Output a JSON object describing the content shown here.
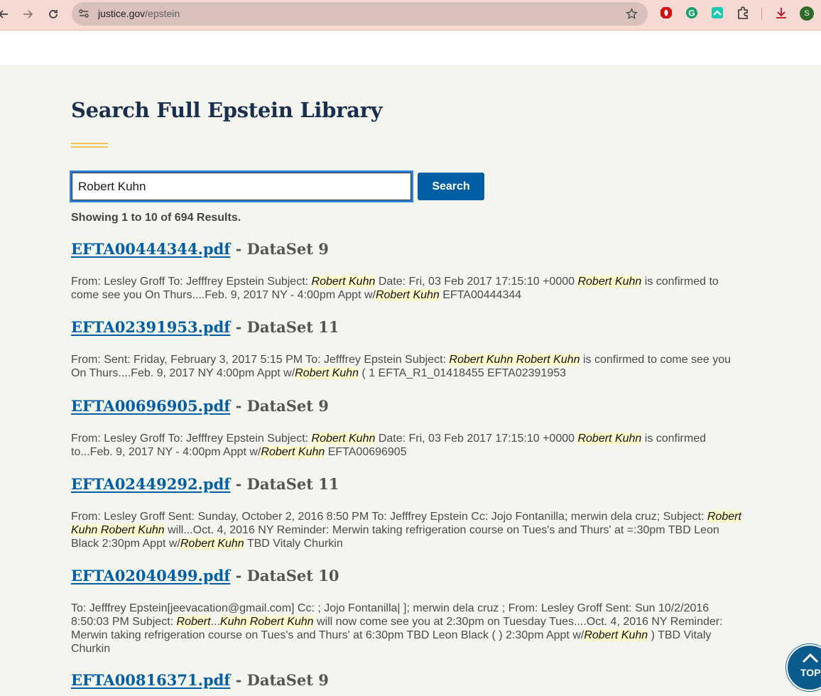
{
  "browser": {
    "url_host": "justice.gov",
    "url_path": "/epstein",
    "avatar_letter": "S"
  },
  "page": {
    "title": "Search Full Epstein Library",
    "search_value": "Robert Kuhn",
    "search_button": "Search",
    "results_count": "Showing 1 to 10 of 694 Results.",
    "top_label": "TOP"
  },
  "results": [
    {
      "file": "EFTA00444344.pdf",
      "dataset": " - DataSet 9",
      "snippet": [
        {
          "t": "From: Lesley Groff To: Jefffrey Epstein Subject: "
        },
        {
          "h": "Robert Kuhn"
        },
        {
          "t": " Date: Fri, 03 Feb 2017 17:15:10 +0000 "
        },
        {
          "h": "Robert Kuhn"
        },
        {
          "t": " is confirmed to come see you On Thurs....Feb. 9, 2017 NY - 4:00pm Appt w/"
        },
        {
          "h": "Robert Kuhn"
        },
        {
          "t": " EFTA00444344"
        }
      ]
    },
    {
      "file": "EFTA02391953.pdf",
      "dataset": " - DataSet 11",
      "snippet": [
        {
          "t": "From: Sent: Friday, February 3, 2017 5:15 PM To: Jefffrey Epstein Subject: "
        },
        {
          "h": "Robert Kuhn Robert Kuhn"
        },
        {
          "t": " is confirmed to come see you On Thurs....Feb. 9, 2017 NY 4:00pm Appt w/"
        },
        {
          "h": "Robert Kuhn"
        },
        {
          "t": " ( 1 EFTA_R1_01418455 EFTA02391953"
        }
      ]
    },
    {
      "file": "EFTA00696905.pdf",
      "dataset": " - DataSet 9",
      "snippet": [
        {
          "t": "From: Lesley Groff To: Jefffrey Epstein Subject: "
        },
        {
          "h": "Robert Kuhn"
        },
        {
          "t": " Date: Fri, 03 Feb 2017 17:15:10 +0000 "
        },
        {
          "h": "Robert Kuhn"
        },
        {
          "t": " is confirmed to...Feb. 9, 2017 NY - 4:00pm Appt w/"
        },
        {
          "h": "Robert Kuhn"
        },
        {
          "t": " EFTA00696905"
        }
      ]
    },
    {
      "file": "EFTA02449292.pdf",
      "dataset": " - DataSet 11",
      "snippet": [
        {
          "t": "From: Lesley Groff Sent: Sunday, October 2, 2016 8:50 PM To: Jefffrey Epstein Cc: Jojo Fontanilla; merwin dela cruz; Subject: "
        },
        {
          "h": "Robert Kuhn Robert Kuhn"
        },
        {
          "t": " will...Oct. 4, 2016 NY Reminder: Merwin taking refrigeration course on Tues's and Thurs' at =:30pm TBD Leon Black 2:30pm Appt w/"
        },
        {
          "h": "Robert Kuhn"
        },
        {
          "t": " TBD Vitaly Churkin"
        }
      ]
    },
    {
      "file": "EFTA02040499.pdf",
      "dataset": " - DataSet 10",
      "snippet": [
        {
          "t": "To: Jefffrey Epstein[jeevacation@gmail.com] Cc: ; Jojo Fontanilla| ]; merwin dela cruz ; From: Lesley Groff Sent: Sun 10/2/2016 8:50:03 PM Subject: "
        },
        {
          "h": "Robert"
        },
        {
          "t": "..."
        },
        {
          "h": "Kuhn Robert Kuhn"
        },
        {
          "t": " will now come see you at 2:30pm on Tuesday Tues....Oct. 4, 2016 NY Reminder: Merwin taking refrigeration course on Tues's and Thurs' at 6:30pm TBD Leon Black ( ) 2:30pm Appt w/"
        },
        {
          "h": "Robert Kuhn"
        },
        {
          "t": " ) TBD Vitaly Churkin"
        }
      ]
    },
    {
      "file": "EFTA00816371.pdf",
      "dataset": " - DataSet 9",
      "snippet": []
    }
  ],
  "colors": {
    "link": "#005ea2",
    "title": "#1a2e4d",
    "accent_rule": "#f2c14e",
    "highlight": "#fffacd"
  }
}
